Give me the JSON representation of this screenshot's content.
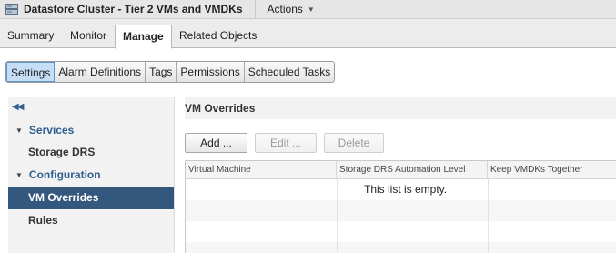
{
  "titlebar": {
    "title": "Datastore Cluster - Tier 2 VMs and VMDKs",
    "icon": "datastore-cluster-icon",
    "actions_label": "Actions",
    "actions_caret": "▼"
  },
  "main_tabs": [
    {
      "label": "Summary",
      "active": false
    },
    {
      "label": "Monitor",
      "active": false
    },
    {
      "label": "Manage",
      "active": true
    },
    {
      "label": "Related Objects",
      "active": false
    }
  ],
  "sub_tabs": [
    {
      "label": "Settings",
      "active": true
    },
    {
      "label": "Alarm Definitions",
      "active": false
    },
    {
      "label": "Tags",
      "active": false
    },
    {
      "label": "Permissions",
      "active": false
    },
    {
      "label": "Scheduled Tasks",
      "active": false
    }
  ],
  "leftnav": {
    "collapse_glyph": "◀◀",
    "sections": [
      {
        "label": "Services",
        "items": [
          {
            "label": "Storage DRS",
            "selected": false
          }
        ]
      },
      {
        "label": "Configuration",
        "items": [
          {
            "label": "VM Overrides",
            "selected": true
          },
          {
            "label": "Rules",
            "selected": false
          }
        ]
      }
    ]
  },
  "content": {
    "title": "VM Overrides",
    "buttons": {
      "add": "Add ...",
      "edit": "Edit ...",
      "delete": "Delete"
    },
    "columns": [
      "Virtual Machine",
      "Storage DRS Automation Level",
      "Keep VMDKs Together"
    ],
    "empty_message": "This list is empty."
  },
  "colors": {
    "selected_nav": "#34577d",
    "section_text": "#2d5f8f",
    "active_subtab": "#c5def5"
  }
}
